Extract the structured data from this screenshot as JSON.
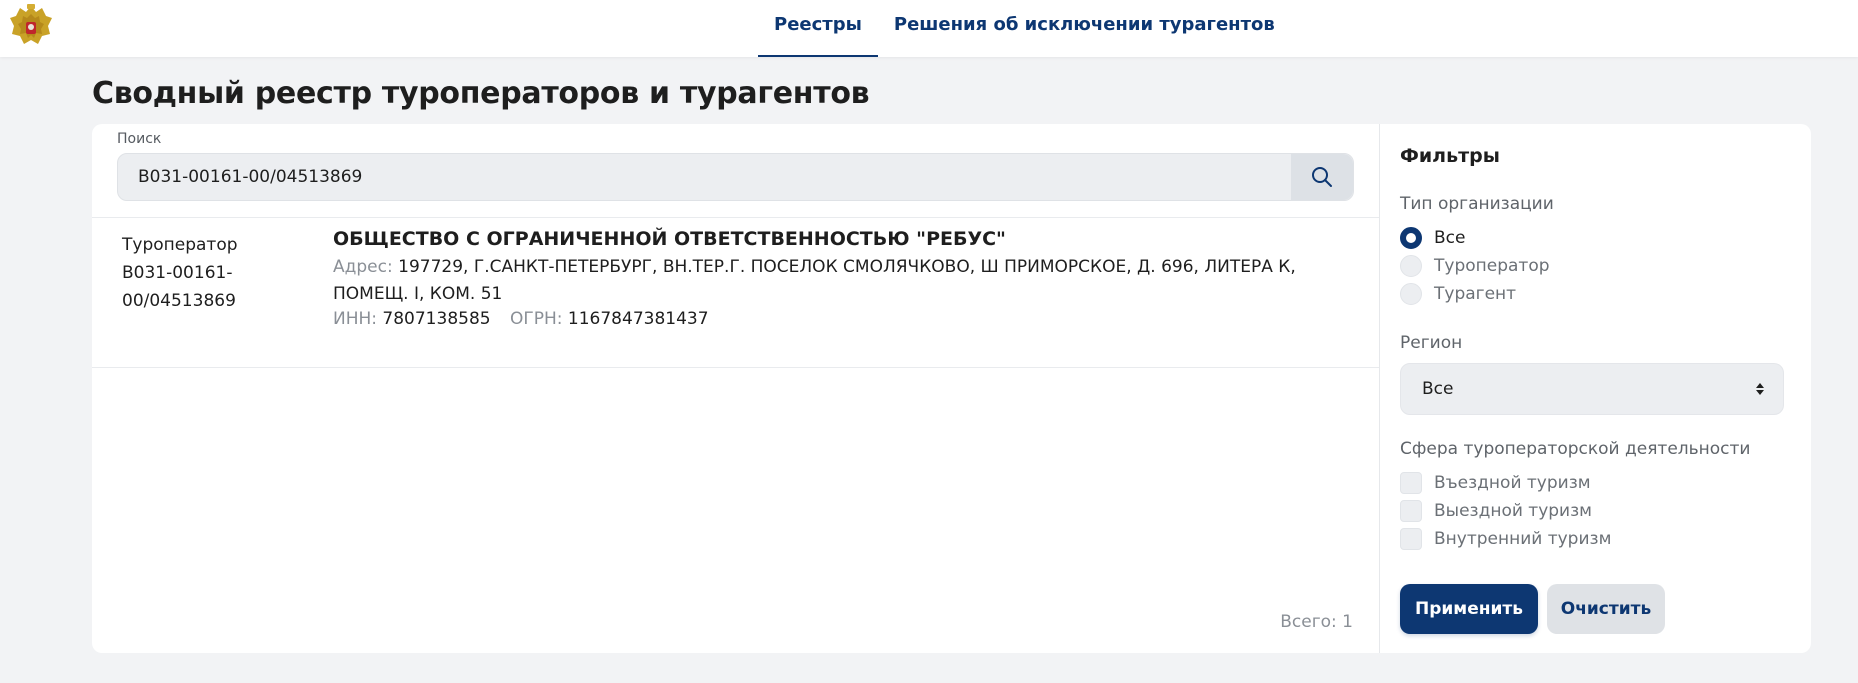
{
  "nav": {
    "items": [
      {
        "label": "Реестры",
        "active": true
      },
      {
        "label": "Решения об исключении турагентов",
        "active": false
      }
    ]
  },
  "page": {
    "title": "Сводный реестр туроператоров и турагентов"
  },
  "search": {
    "label": "Поиск",
    "value": "В031-00161-00/04513869",
    "icon": "search-icon"
  },
  "results": [
    {
      "type": "Туроператор",
      "reg_number_line1": "В031-00161-",
      "reg_number_line2": "00/04513869",
      "name": "ОБЩЕСТВО С ОГРАНИЧЕННОЙ ОТВЕТСТВЕННОСТЬЮ \"РЕБУС\"",
      "address_label": "Адрес:",
      "address": "197729, Г.САНКТ-ПЕТЕРБУРГ, ВН.ТЕР.Г. ПОСЕЛОК СМОЛЯЧКОВО, Ш ПРИМОРСКОЕ, Д. 696, ЛИТЕРА К, ПОМЕЩ. I, КОМ. 51",
      "inn_label": "ИНН:",
      "inn": "7807138585",
      "ogrn_label": "ОГРН:",
      "ogrn": "1167847381437"
    }
  ],
  "total": "Всего: 1",
  "filters": {
    "title": "Фильтры",
    "org_type": {
      "label": "Тип организации",
      "options": [
        {
          "label": "Все",
          "selected": true
        },
        {
          "label": "Туроператор",
          "selected": false
        },
        {
          "label": "Турагент",
          "selected": false
        }
      ]
    },
    "region": {
      "label": "Регион",
      "value": "Все"
    },
    "sphere": {
      "label": "Сфера туроператорской деятельности",
      "options": [
        {
          "label": "Въездной туризм",
          "checked": false
        },
        {
          "label": "Выездной туризм",
          "checked": false
        },
        {
          "label": "Внутренний туризм",
          "checked": false
        }
      ]
    },
    "apply_label": "Применить",
    "clear_label": "Очистить"
  },
  "colors": {
    "brand": "#0d3772",
    "background": "#f2f3f5",
    "muted": "#8a8f96"
  }
}
